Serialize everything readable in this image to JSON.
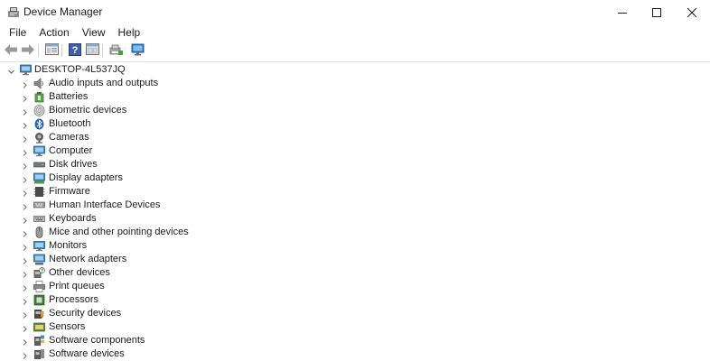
{
  "window": {
    "title": "Device Manager",
    "icon": "device-manager-icon",
    "controls": [
      "minimize-icon",
      "maximize-icon",
      "close-icon"
    ]
  },
  "menu": {
    "items": [
      "File",
      "Action",
      "View",
      "Help"
    ]
  },
  "toolbar": {
    "buttons": [
      "back-arrow-icon",
      "forward-arrow-icon",
      "properties-window-icon",
      "help-icon",
      "view-pane-icon",
      "update-driver-icon",
      "scan-hardware-icon"
    ]
  },
  "tree": {
    "root": "DESKTOP-4L537JQ",
    "categories": [
      {
        "label": "Audio inputs and outputs",
        "icon": "speaker-icon"
      },
      {
        "label": "Batteries",
        "icon": "battery-icon"
      },
      {
        "label": "Biometric devices",
        "icon": "fingerprint-icon"
      },
      {
        "label": "Bluetooth",
        "icon": "bluetooth-icon"
      },
      {
        "label": "Cameras",
        "icon": "camera-icon"
      },
      {
        "label": "Computer",
        "icon": "computer-icon"
      },
      {
        "label": "Disk drives",
        "icon": "disk-drive-icon"
      },
      {
        "label": "Display adapters",
        "icon": "display-adapter-icon"
      },
      {
        "label": "Firmware",
        "icon": "firmware-icon"
      },
      {
        "label": "Human Interface Devices",
        "icon": "hid-icon"
      },
      {
        "label": "Keyboards",
        "icon": "keyboard-icon"
      },
      {
        "label": "Mice and other pointing devices",
        "icon": "mouse-icon"
      },
      {
        "label": "Monitors",
        "icon": "monitor-icon"
      },
      {
        "label": "Network adapters",
        "icon": "network-adapter-icon"
      },
      {
        "label": "Other devices",
        "icon": "unknown-device-icon"
      },
      {
        "label": "Print queues",
        "icon": "printer-icon"
      },
      {
        "label": "Processors",
        "icon": "processor-icon"
      },
      {
        "label": "Security devices",
        "icon": "security-device-icon"
      },
      {
        "label": "Sensors",
        "icon": "sensor-icon"
      },
      {
        "label": "Software components",
        "icon": "software-component-icon"
      },
      {
        "label": "Software devices",
        "icon": "software-device-icon"
      }
    ]
  },
  "colors": {
    "background": "#ffffff",
    "text": "#1b1b1b",
    "chevron": "#7a7a7a",
    "separator": "#e3e3e3",
    "accent": "#2e7fd0"
  }
}
